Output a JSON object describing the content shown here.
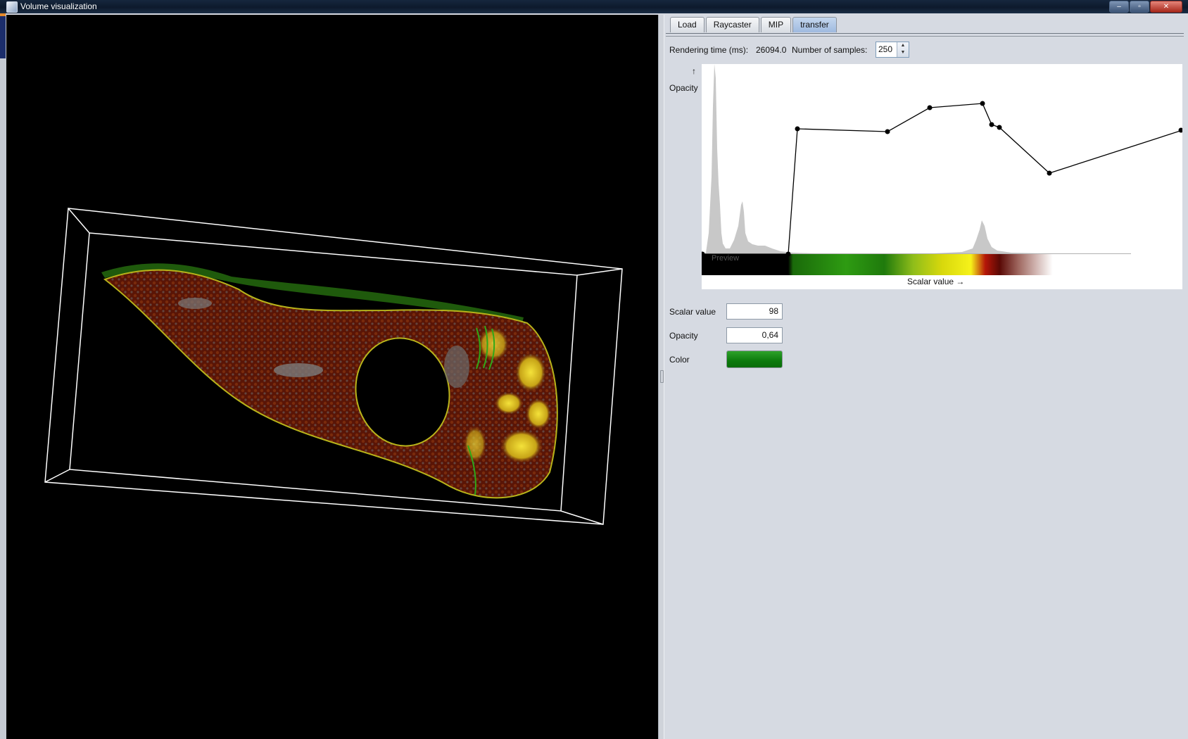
{
  "window": {
    "title": "Volume visualization",
    "controls": {
      "minimize": "–",
      "maximize": "▫",
      "close": "✕"
    }
  },
  "tabs": [
    {
      "label": "Load",
      "active": false
    },
    {
      "label": "Raycaster",
      "active": false
    },
    {
      "label": "MIP",
      "active": false
    },
    {
      "label": "transfer",
      "active": true
    }
  ],
  "stats": {
    "rendering_time_label": "Rendering time (ms):",
    "rendering_time_value": "26094.0",
    "samples_label": "Number of samples:",
    "samples_value": "250"
  },
  "transfer": {
    "y_arrow": "↑",
    "y_label": "Opacity",
    "x_label": "Scalar value →",
    "preview_label": "Preview",
    "colors": {
      "histogram": "#c8c8c8",
      "curve": "#000000"
    }
  },
  "editor": {
    "scalar_label": "Scalar value",
    "scalar_value": "98",
    "opacity_label": "Opacity",
    "opacity_value": "0,64",
    "color_label": "Color",
    "color_value": "#138a13"
  }
}
